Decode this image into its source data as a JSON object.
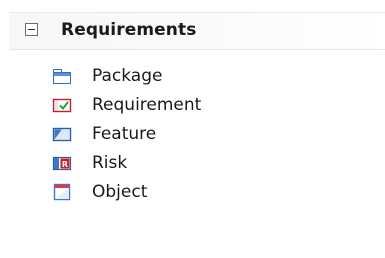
{
  "toolbox": {
    "group": {
      "title": "Requirements",
      "expanded": true,
      "toggle_icon": "collapse-minus-icon"
    },
    "items": [
      {
        "label": "Package",
        "icon": "package-icon"
      },
      {
        "label": "Requirement",
        "icon": "requirement-icon"
      },
      {
        "label": "Feature",
        "icon": "feature-icon"
      },
      {
        "label": "Risk",
        "icon": "risk-icon"
      },
      {
        "label": "Object",
        "icon": "object-icon"
      }
    ]
  },
  "colors": {
    "package_blue": "#2d6fc4",
    "requirement_red": "#c21f2f",
    "check_green": "#2f9e2f",
    "risk_red": "#d41c1c",
    "object_blue": "#3a7bd0"
  }
}
